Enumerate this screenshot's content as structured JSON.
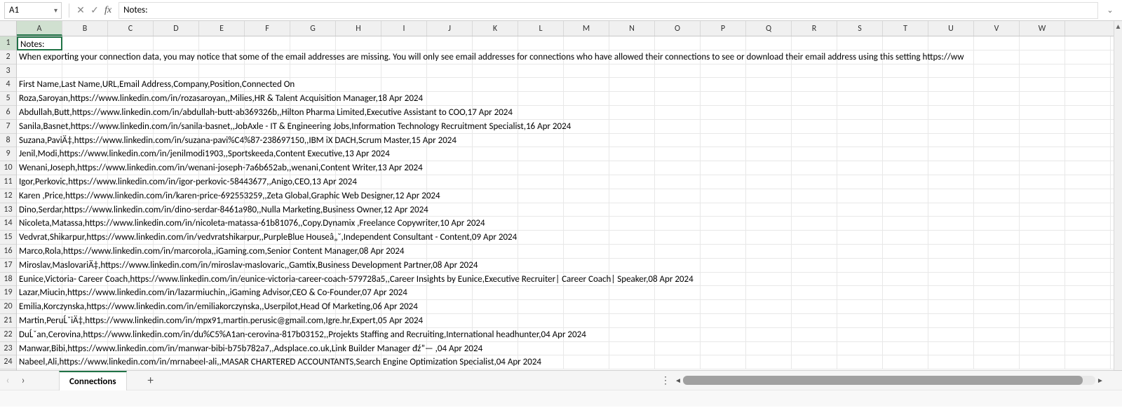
{
  "formulaBar": {
    "cellRef": "A1",
    "value": "Notes:"
  },
  "columns": [
    "A",
    "B",
    "C",
    "D",
    "E",
    "F",
    "G",
    "H",
    "I",
    "J",
    "K",
    "L",
    "M",
    "N",
    "O",
    "P",
    "Q",
    "R",
    "S",
    "T",
    "U",
    "V",
    "W"
  ],
  "selectedCell": {
    "row": 1,
    "col": "A"
  },
  "rows": [
    {
      "n": 1,
      "text": "Notes:"
    },
    {
      "n": 2,
      "text": "When exporting your connection data, you may notice that some of the email addresses are missing. You will only see email addresses for connections who have allowed their connections to see or download their email address using this setting https://ww"
    },
    {
      "n": 3,
      "text": ""
    },
    {
      "n": 4,
      "text": "First Name,Last Name,URL,Email Address,Company,Position,Connected On"
    },
    {
      "n": 5,
      "text": "Roza,Saroyan,https://www.linkedin.com/in/rozasaroyan,,Milies,HR & Talent Acquisition Manager,18 Apr 2024"
    },
    {
      "n": 6,
      "text": "Abdullah,Butt,https://www.linkedin.com/in/abdullah-butt-ab369326b,,Hilton Pharma Limited,Executive Assistant to COO,17 Apr 2024"
    },
    {
      "n": 7,
      "text": "Sanila,Basnet,https://www.linkedin.com/in/sanila-basnet,,JobAxle - IT & Engineering Jobs,Information Technology Recruitment Specialist,16 Apr 2024"
    },
    {
      "n": 8,
      "text": "Suzana,PaviÄ‡,https://www.linkedin.com/in/suzana-pavi%C4%87-238697150,,IBM iX DACH,Scrum Master,15 Apr 2024"
    },
    {
      "n": 9,
      "text": "Jenil,Modi,https://www.linkedin.com/in/jenilmodi1903,,Sportskeeda,Content Executive,13 Apr 2024"
    },
    {
      "n": 10,
      "text": "Wenani,Joseph,https://www.linkedin.com/in/wenani-joseph-7a6b652ab,,wenani,Content Writer,13 Apr 2024"
    },
    {
      "n": 11,
      "text": "Igor,Perkovic,https://www.linkedin.com/in/igor-perkovic-58443677,,Anigo,CEO,13 Apr 2024"
    },
    {
      "n": 12,
      "text": "Karen ,Price,https://www.linkedin.com/in/karen-price-692553259,,Zeta Global,Graphic Web Designer,12 Apr 2024"
    },
    {
      "n": 13,
      "text": "Dino,Serdar,https://www.linkedin.com/in/dino-serdar-8461a980,,Nulla Marketing,Business Owner,12 Apr 2024"
    },
    {
      "n": 14,
      "text": "Nicoleta,Matassa,https://www.linkedin.com/in/nicoleta-matassa-61b81076,,Copy.Dynamix ,Freelance Copywriter,10 Apr 2024"
    },
    {
      "n": 15,
      "text": "Vedvrat,Shikarpur,https://www.linkedin.com/in/vedvratshikarpur,,PurpleBlue Houseâ„˘,Independent Consultant - Content,09 Apr 2024"
    },
    {
      "n": 16,
      "text": "Marco,Rola,https://www.linkedin.com/in/marcorola,,iGaming.com,Senior Content Manager,08 Apr 2024"
    },
    {
      "n": 17,
      "text": "Miroslav,MaslovariÄ‡,https://www.linkedin.com/in/miroslav-maslovaric,,Gamtix,Business Development Partner,08 Apr 2024"
    },
    {
      "n": 18,
      "text": "Eunice,Victoria- Career  Coach,https://www.linkedin.com/in/eunice-victoria-career-coach-579728a5,,Career Insights by Eunice,Executive Recruiter| Career Coach| Speaker,08 Apr 2024"
    },
    {
      "n": 19,
      "text": "Lazar,Miucin,https://www.linkedin.com/in/lazarmiuchin,,iGaming Advisor,CEO & Co-Founder,07 Apr 2024"
    },
    {
      "n": 20,
      "text": "Emilia,Korczynska,https://www.linkedin.com/in/emiliakorczynska,,Userpilot,Head Of Marketing,06 Apr 2024"
    },
    {
      "n": 21,
      "text": "Martin,PeruĹˇiÄ‡,https://www.linkedin.com/in/mpx91,martin.perusic@gmail.com,Igre.hr,Expert,05 Apr 2024"
    },
    {
      "n": 22,
      "text": "DuĹˇan,Cerovina,https://www.linkedin.com/in/du%C5%A1an-cerovina-817b03152,,Projekts Staffing and Recruiting,International headhunter,04 Apr 2024"
    },
    {
      "n": 23,
      "text": "Manwar,Bibi,https://www.linkedin.com/in/manwar-bibi-b75b782a7,,Adsplace.co.uk,Link Builder Manager đź”— ,04 Apr 2024"
    },
    {
      "n": 24,
      "text": "Nabeel,Ali,https://www.linkedin.com/in/mrnabeel-ali,,MASAR CHARTERED ACCOUNTANTS,Search Engine Optimization Specialist,04 Apr 2024"
    }
  ],
  "sheet": {
    "name": "Connections"
  }
}
